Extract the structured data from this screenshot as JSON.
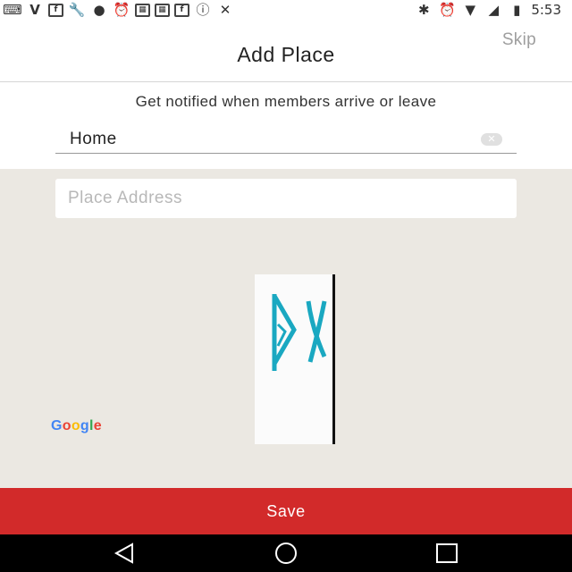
{
  "status_bar": {
    "time": "5:53",
    "left_icons": [
      "keyboard-icon",
      "v-icon",
      "flipboard-icon",
      "wrench-icon",
      "location-icon",
      "alarm-icon",
      "notification-box-icon",
      "notification-box-icon",
      "flipboard-icon",
      "info-icon",
      "no-signal-icon"
    ],
    "right_icons": [
      "bluetooth-icon",
      "alarm-icon",
      "wifi-icon",
      "cellular-icon",
      "battery-icon"
    ]
  },
  "header": {
    "title": "Add Place",
    "skip_label": "Skip"
  },
  "form": {
    "subtitle": "Get notified when members arrive or leave",
    "place_name_value": "Home"
  },
  "map": {
    "address_placeholder": "Place Address",
    "attribution": [
      "G",
      "o",
      "o",
      "g",
      "l",
      "e"
    ],
    "attribution_colors": [
      "#4285F4",
      "#EA4335",
      "#FBBC05",
      "#4285F4",
      "#34A853",
      "#EA4335"
    ]
  },
  "footer": {
    "save_label": "Save"
  },
  "colors": {
    "accent": "#d22a2a",
    "map_background": "#ebe8e2",
    "marker_teal": "#1aa8c1"
  }
}
